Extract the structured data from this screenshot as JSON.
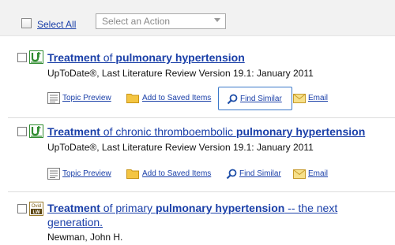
{
  "toolbar": {
    "select_all": "Select All",
    "action_placeholder": "Select an Action"
  },
  "results": [
    {
      "title_parts": [
        "Treatment",
        " of ",
        "pulmonary hypertension"
      ],
      "meta": "UpToDate®, Last Literature Review Version 19.1: January 2011",
      "actions": {
        "topic_preview": "Topic Preview",
        "add_saved": "Add to Saved Items",
        "find_similar": "Find Similar",
        "email": "Email"
      }
    },
    {
      "title_parts": [
        "Treatment",
        " of chronic thromboembolic ",
        "pulmonary hypertension"
      ],
      "meta": "UpToDate®, Last Literature Review Version 19.1: January 2011",
      "actions": {
        "topic_preview": "Topic Preview",
        "add_saved": "Add to Saved Items",
        "find_similar": "Find Similar",
        "email": "Email"
      }
    },
    {
      "title_parts": [
        "Treatment",
        " of primary ",
        "pulmonary hypertension",
        " -- the next generation."
      ],
      "meta": "Newman, John H."
    }
  ],
  "icons": {
    "uptodate": "uptodate-source-icon",
    "ovid": "ovid-source-icon",
    "ovid_text_top": "Ovid",
    "ovid_text_bottom": "LW"
  },
  "colors": {
    "link": "#1a3fa8",
    "uptodate_green": "#2e8b2e",
    "highlight_border": "#3a78c9"
  }
}
